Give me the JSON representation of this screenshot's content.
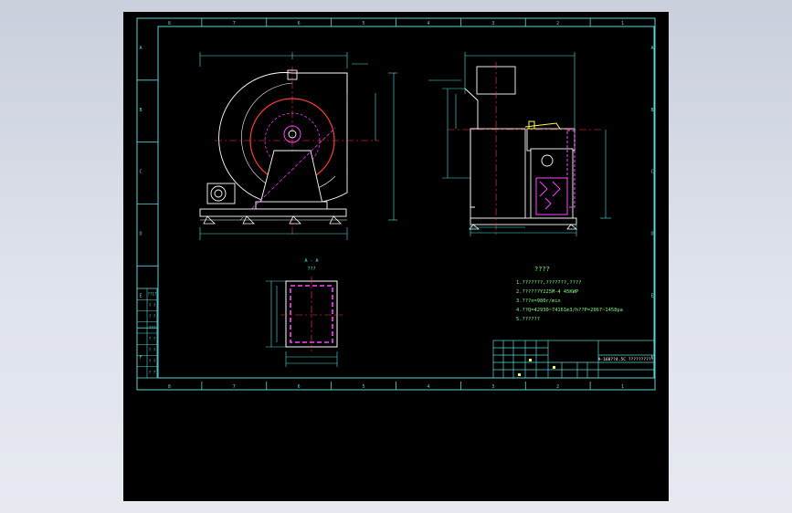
{
  "colors": {
    "frame": "#5ad6d6",
    "geometry": "#ffffff",
    "dimension": "#4fe3e3",
    "centerline": "#ff3b3b",
    "accent": "#ff44ff",
    "notes": "#7dff7d",
    "highlight": "#ffff55",
    "background": "#000000"
  },
  "section": {
    "label": "A - A",
    "sublabel": "???"
  },
  "notes": {
    "title": "????",
    "items": [
      "1.???????,???????,????",
      "2.??????Y225M-4 45KWP",
      "3.???n=980r/min",
      "4.??Q=42930~74161m3/h??P=2067~1458pa",
      "5.??????"
    ]
  },
  "title_block": {
    "title": "A-168??4.5C ??????????"
  },
  "left_panel": [
    "??1?",
    "? ?",
    "? ?",
    "???",
    "? ?",
    "? ?",
    "? ?",
    "? ?"
  ],
  "frame_marks": {
    "top": [
      "8",
      "7",
      "6",
      "5",
      "4",
      "3",
      "2",
      "1"
    ],
    "side": [
      "A",
      "B",
      "C",
      "D",
      "E",
      "F"
    ]
  }
}
